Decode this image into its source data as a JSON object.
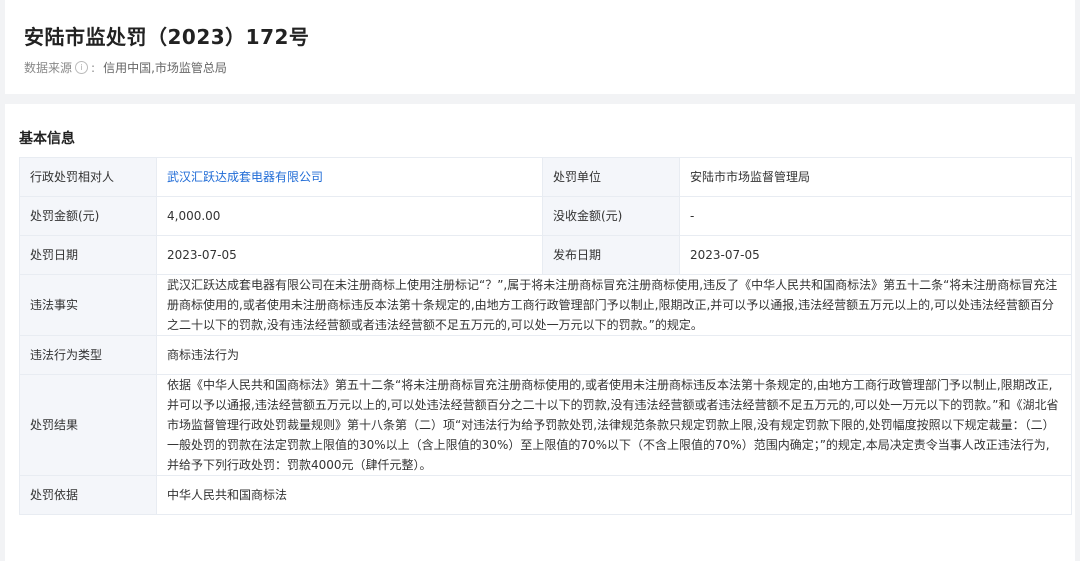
{
  "header": {
    "title": "安陆市监处罚（2023）172号",
    "source_label": "数据来源",
    "source_value": "信用中国,市场监管总局"
  },
  "section": {
    "title": "基本信息"
  },
  "table": {
    "party_label": "行政处罚相对人",
    "party_value": "武汉汇跃达成套电器有限公司",
    "unit_label": "处罚单位",
    "unit_value": "安陆市市场监督管理局",
    "amount_label": "处罚金额(元)",
    "amount_value": "4,000.00",
    "confiscated_label": "没收金额(元)",
    "confiscated_value": "-",
    "date_label": "处罚日期",
    "date_value": "2023-07-05",
    "publish_label": "发布日期",
    "publish_value": "2023-07-05",
    "facts_label": "违法事实",
    "facts_value": "武汉汇跃达成套电器有限公司在未注册商标上使用注册标记“？”,属于将未注册商标冒充注册商标使用,违反了《中华人民共和国商标法》第五十二条“将未注册商标冒充注册商标使用的,或者使用未注册商标违反本法第十条规定的,由地方工商行政管理部门予以制止,限期改正,并可以予以通报,违法经营额五万元以上的,可以处违法经营额百分之二十以下的罚款,没有违法经营额或者违法经营额不足五万元的,可以处一万元以下的罚款。”的规定。",
    "type_label": "违法行为类型",
    "type_value": "商标违法行为",
    "result_label": "处罚结果",
    "result_value": "依据《中华人民共和国商标法》第五十二条“将未注册商标冒充注册商标使用的,或者使用未注册商标违反本法第十条规定的,由地方工商行政管理部门予以制止,限期改正,并可以予以通报,违法经营额五万元以上的,可以处违法经营额百分之二十以下的罚款,没有违法经营额或者违法经营额不足五万元的,可以处一万元以下的罚款。”和《湖北省市场监督管理行政处罚裁量规则》第十八条第（二）项“对违法行为给予罚款处罚,法律规范条款只规定罚款上限,没有规定罚款下限的,处罚幅度按照以下规定裁量：（二）一般处罚的罚款在法定罚款上限值的30%以上（含上限值的30%）至上限值的70%以下（不含上限值的70%）范围内确定；”的规定,本局决定责令当事人改正违法行为,并给予下列行政处罚：罚款4000元（肆仟元整）。",
    "basis_label": "处罚依据",
    "basis_value": "中华人民共和国商标法"
  }
}
